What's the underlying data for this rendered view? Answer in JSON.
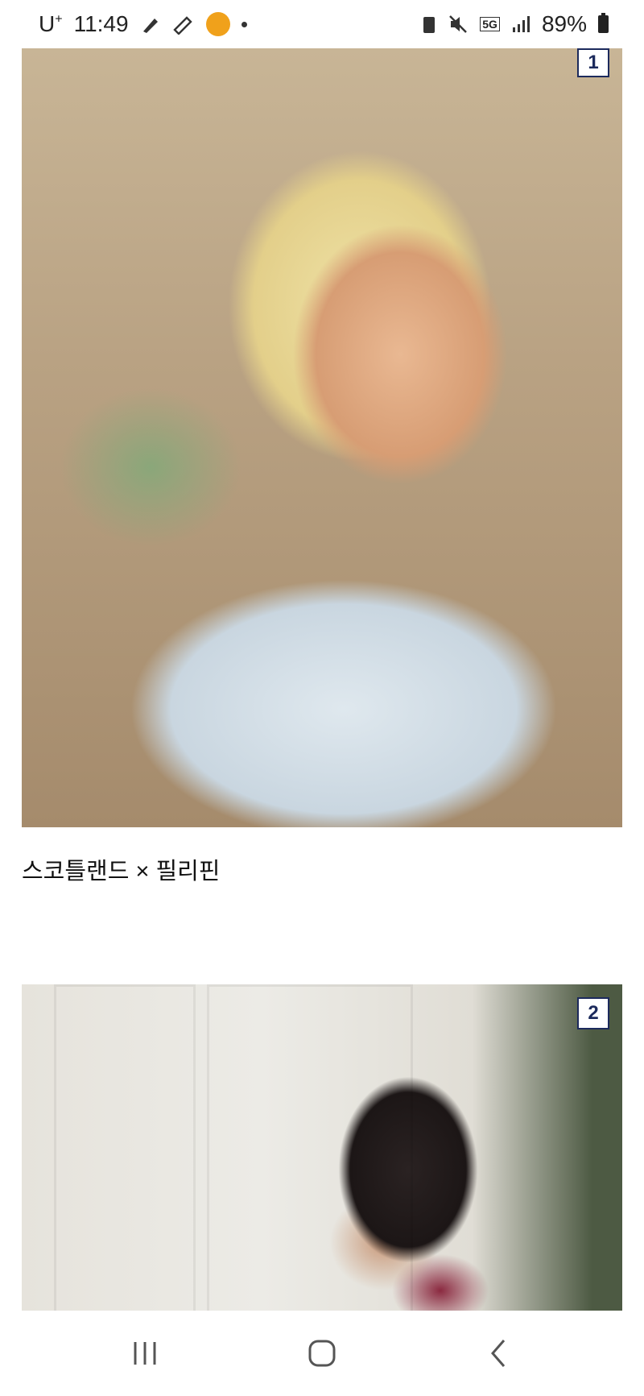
{
  "status_bar": {
    "carrier": "U",
    "carrier_sup": "+",
    "time": "11:49",
    "network": "5G",
    "battery": "89%"
  },
  "posts": [
    {
      "badge": "1"
    },
    {
      "badge": "2"
    }
  ],
  "caption": "스코틀랜드 × 필리핀",
  "nav": {
    "icons": [
      "recent-apps-icon",
      "home-icon",
      "back-icon"
    ]
  }
}
